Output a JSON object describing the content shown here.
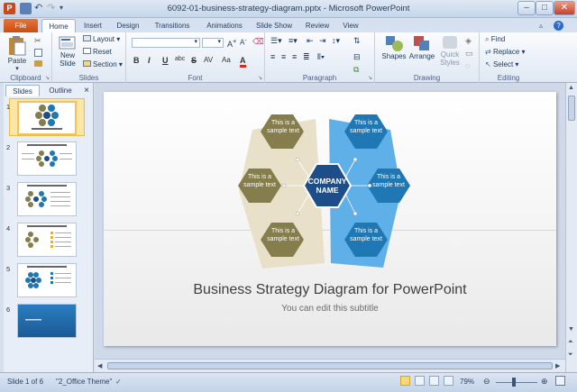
{
  "window": {
    "title": "6092-01-business-strategy-diagram.pptx - Microsoft PowerPoint"
  },
  "tabs": [
    "File",
    "Home",
    "Insert",
    "Design",
    "Transitions",
    "Animations",
    "Slide Show",
    "Review",
    "View"
  ],
  "ribbon": {
    "clipboard": {
      "paste": "Paste",
      "label": "Clipboard"
    },
    "slides": {
      "new_slide_1": "New",
      "new_slide_2": "Slide",
      "layout": "Layout",
      "reset": "Reset",
      "section": "Section",
      "label": "Slides"
    },
    "font": {
      "bold": "B",
      "italic": "I",
      "underline": "U",
      "strike": "S",
      "shadow": "abc",
      "spacing": "AV",
      "case": "Aa",
      "color": "A",
      "label": "Font"
    },
    "paragraph": {
      "label": "Paragraph"
    },
    "drawing": {
      "shapes": "Shapes",
      "arrange": "Arrange",
      "quick_styles_1": "Quick",
      "quick_styles_2": "Styles",
      "label": "Drawing"
    },
    "editing": {
      "find": "Find",
      "replace": "Replace",
      "select": "Select",
      "label": "Editing"
    }
  },
  "panel": {
    "tab_slides": "Slides",
    "tab_outline": "Outline",
    "close": "×"
  },
  "thumbnails": [
    "1",
    "2",
    "3",
    "4",
    "5",
    "6"
  ],
  "slide": {
    "center": "COMPANY NAME",
    "hex_text": "This is a sample text",
    "title": "Business Strategy Diagram for PowerPoint",
    "subtitle": "You can edit this subtitle"
  },
  "colors": {
    "olive": "#857d4b",
    "blue": "#1f78b4",
    "navy": "#1d4e89",
    "light_blue": "#5fb0e8",
    "beige": "#e8e0c8"
  },
  "status": {
    "slide_info": "Slide 1 of 6",
    "theme": "\"2_Office Theme\"",
    "zoom": "79%"
  }
}
